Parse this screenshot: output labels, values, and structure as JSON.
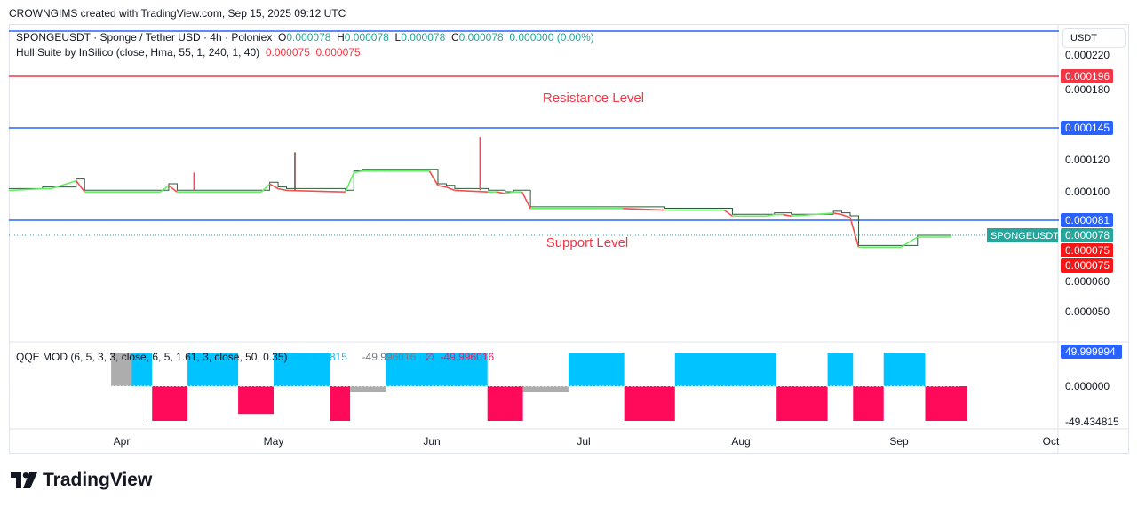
{
  "header": {
    "credit": "CROWNGIMS created with TradingView.com, Sep 15, 2025 09:12 UTC"
  },
  "legend": {
    "symbol": "SPONGEUSDT · Sponge / Tether USD · 4h · Poloniex",
    "o_label": "O",
    "o_value": "0.000078",
    "h_label": "H",
    "h_value": "0.000078",
    "l_label": "L",
    "l_value": "0.000078",
    "c_label": "C",
    "c_value": "0.000078",
    "change": "0.000000 (0.00%)",
    "indicator_name": "Hull Suite by InSilico (close, Hma, 55, 1, 240, 1, 40)",
    "indicator_v1": "0.000075",
    "indicator_v2": "0.000075",
    "qqe_name": "QQE MOD (6, 5, 3, 3, close, 6, 5, 1.61, 3, close, 50, 0.35)",
    "qqe_v1": "-49.434815",
    "qqe_v2": "-49.996016",
    "qqe_sym": "∅",
    "qqe_v3": "-49.996016"
  },
  "currency": "USDT",
  "brand": "TradingView",
  "icons": {
    "brand_mark": "tradingview-logo-icon"
  },
  "colors": {
    "hline_blue": "#2962ff",
    "hline_red": "#f23645",
    "hull_up": "#66ee66",
    "hull_down": "#f05050",
    "qqe_up": "#00c3ff",
    "qqe_down": "#ff0a5a",
    "qqe_neutral": "#999999",
    "price_tag": "#26a69a",
    "annot": "#f23645"
  },
  "chart_data": [
    {
      "type": "line",
      "title": "",
      "x": [
        "Apr",
        "May",
        "Jun",
        "Jul",
        "Aug",
        "Sep",
        "Oct"
      ],
      "y_ticks": [
        "0.000220",
        "0.000180",
        "0.000120",
        "0.000100",
        "0.000060",
        "0.000050"
      ],
      "ylim": [
        4e-05,
        0.00025
      ],
      "horizontal_lines": [
        {
          "value": 0.000223,
          "color": "blue"
        },
        {
          "value": 0.000196,
          "color": "red",
          "label": "0.000196"
        },
        {
          "value": 0.000145,
          "color": "blue",
          "label": "0.000145"
        },
        {
          "value": 8.1e-05,
          "color": "blue",
          "label": "0.000081"
        }
      ],
      "annotations": [
        "Resistance Level",
        "Support Level"
      ],
      "price_labels": [
        {
          "name": "SPONGEUSDT",
          "value": "0.000078"
        },
        {
          "value": "0.000075"
        },
        {
          "value": "0.000075"
        }
      ],
      "price_series": {
        "name": "SPONGEUSDT",
        "x": [
          0,
          4,
          5,
          8,
          9,
          12,
          13,
          18,
          19,
          20,
          21,
          30,
          31,
          32,
          33,
          40,
          41,
          42,
          43,
          44,
          45,
          50,
          51,
          52,
          53,
          57,
          58,
          59,
          60,
          61,
          62,
          70,
          71,
          72,
          73,
          78,
          79,
          80,
          85,
          86,
          87,
          90,
          91,
          92,
          93,
          98,
          99,
          100,
          101,
          104,
          106,
          108,
          110,
          112
        ],
        "y": [
          0.000102,
          0.000103,
          0.000103,
          0.000108,
          0.000101,
          0.000101,
          0.000101,
          0.000101,
          0.000105,
          0.000101,
          0.000101,
          0.000101,
          0.000106,
          0.000103,
          0.000102,
          0.000101,
          0.000113,
          0.000114,
          0.000114,
          0.000114,
          0.000114,
          0.000114,
          0.000105,
          0.000104,
          0.000102,
          0.000101,
          0.000101,
          0.0001,
          0.000101,
          0.000101,
          9e-05,
          9e-05,
          9e-05,
          9e-05,
          9e-05,
          8.9e-05,
          8.9e-05,
          8.9e-05,
          8.9e-05,
          8.5e-05,
          8.5e-05,
          8.5e-05,
          8.6e-05,
          8.6e-05,
          8.5e-05,
          8.7e-05,
          8.6e-05,
          8.4e-05,
          7.6e-05,
          7.6e-05,
          7.6e-05,
          7.8e-05,
          7.8e-05,
          7.8e-05
        ]
      },
      "wicks": [
        {
          "x": 22,
          "high": 0.000112
        },
        {
          "x": 34,
          "high": 0.000126
        },
        {
          "x": 56,
          "high": 0.000138
        }
      ]
    },
    {
      "type": "bar",
      "title": "QQE MOD",
      "y_ticks": [
        "49.999994",
        "0.000000",
        "-49.434815"
      ],
      "ylim": [
        -50,
        50
      ],
      "segments": [
        {
          "from": "Mar 24",
          "to": "Mar 30",
          "state": "neutral",
          "value": 50
        },
        {
          "from": "Mar 31",
          "to": "Apr 3",
          "state": "down",
          "value": -50
        },
        {
          "from": "Apr 3",
          "to": "Apr 7",
          "state": "up",
          "value": 50
        },
        {
          "from": "Apr 7",
          "to": "Apr 14",
          "state": "down",
          "value": -50
        },
        {
          "from": "Apr 14",
          "to": "Apr 24",
          "state": "up",
          "value": 50
        },
        {
          "from": "Apr 24",
          "to": "May 1",
          "state": "down",
          "value": -40
        },
        {
          "from": "May 1",
          "to": "May 12",
          "state": "up",
          "value": 50
        },
        {
          "from": "May 12",
          "to": "May 16",
          "state": "down",
          "value": -50
        },
        {
          "from": "May 16",
          "to": "May 23",
          "state": "neutral",
          "value": -10
        },
        {
          "from": "May 23",
          "to": "Jun 12",
          "state": "up",
          "value": 50
        },
        {
          "from": "Jun 12",
          "to": "Jun 19",
          "state": "down",
          "value": -50
        },
        {
          "from": "Jun 19",
          "to": "Jun 28",
          "state": "neutral",
          "value": -15
        },
        {
          "from": "Jun 28",
          "to": "Jul 9",
          "state": "up",
          "value": 50
        },
        {
          "from": "Jul 9",
          "to": "Jul 19",
          "state": "down",
          "value": -50
        },
        {
          "from": "Jul 19",
          "to": "Aug 8",
          "state": "up",
          "value": 50
        },
        {
          "from": "Aug 8",
          "to": "Aug 18",
          "state": "down",
          "value": -50
        },
        {
          "from": "Aug 18",
          "to": "Aug 23",
          "state": "up",
          "value": 50
        },
        {
          "from": "Aug 23",
          "to": "Aug 29",
          "state": "down",
          "value": -50
        },
        {
          "from": "Aug 29",
          "to": "Sep 6",
          "state": "up",
          "value": 50
        },
        {
          "from": "Sep 6",
          "to": "Sep 14",
          "state": "down",
          "value": -50
        }
      ]
    }
  ]
}
